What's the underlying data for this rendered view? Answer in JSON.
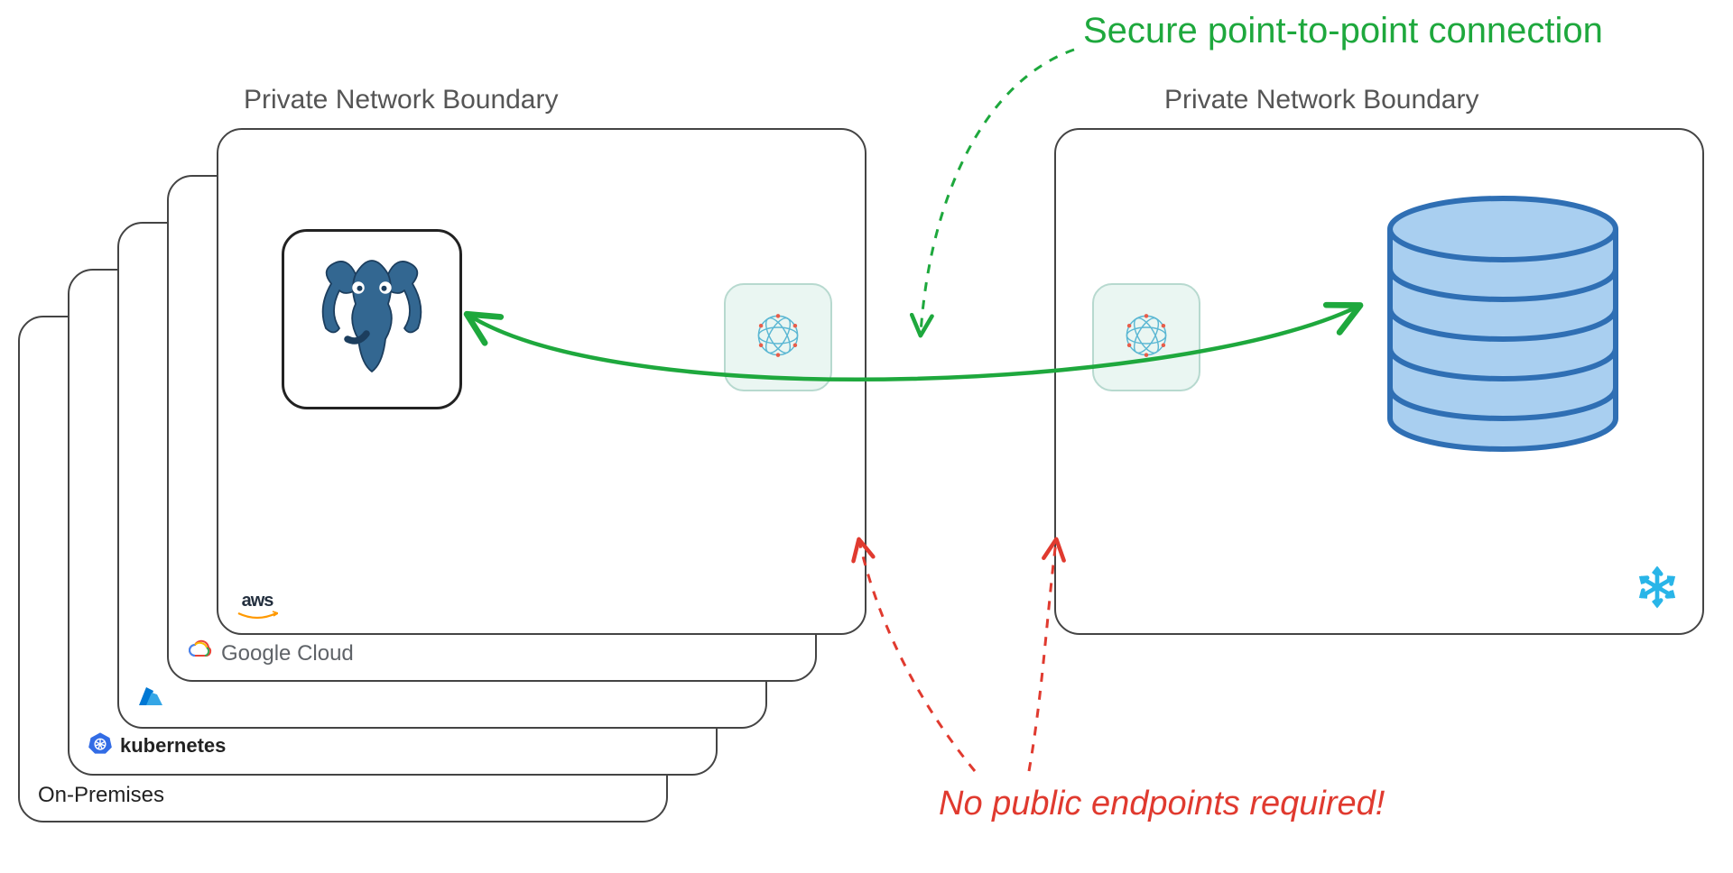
{
  "left_boundary_label": "Private Network Boundary",
  "right_boundary_label": "Private Network Boundary",
  "annotation_secure": "Secure point-to-point connection",
  "annotation_nopublic": "No public endpoints required!",
  "providers": {
    "aws": "aws",
    "gcp": "Google Cloud",
    "azure": "Azure",
    "k8s": "kubernetes",
    "onprem": "On-Premises"
  },
  "colors": {
    "green": "#1ea83d",
    "red": "#e03a2f",
    "db_fill": "#a9cff0",
    "db_stroke": "#2f6fb4",
    "snowflake": "#29b5e8",
    "postgres": "#336791"
  }
}
